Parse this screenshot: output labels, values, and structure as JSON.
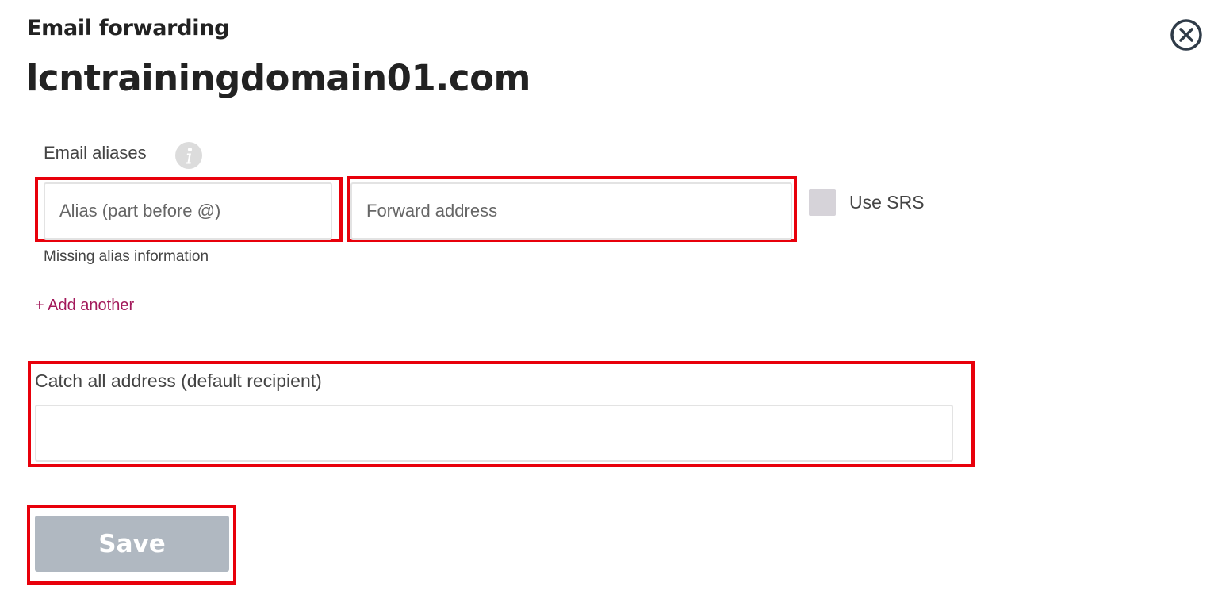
{
  "header": {
    "subtitle": "Email forwarding",
    "domain": "lcntrainingdomain01.com"
  },
  "icons": {
    "close": "close-icon",
    "info": "info-icon"
  },
  "aliases": {
    "label": "Email aliases",
    "alias_placeholder": "Alias (part before @)",
    "alias_value": "",
    "forward_placeholder": "Forward address",
    "forward_value": "",
    "srs_label": "Use SRS",
    "srs_checked": false,
    "error": "Missing alias information",
    "add_another": "+ Add another"
  },
  "catch_all": {
    "label": "Catch all address (default recipient)",
    "value": "",
    "placeholder": ""
  },
  "actions": {
    "save_label": "Save"
  },
  "colors": {
    "highlight": "#e8000b",
    "link": "#a3195b",
    "save_button_disabled": "#b0b8c1",
    "checkbox": "#d6d3d9"
  }
}
